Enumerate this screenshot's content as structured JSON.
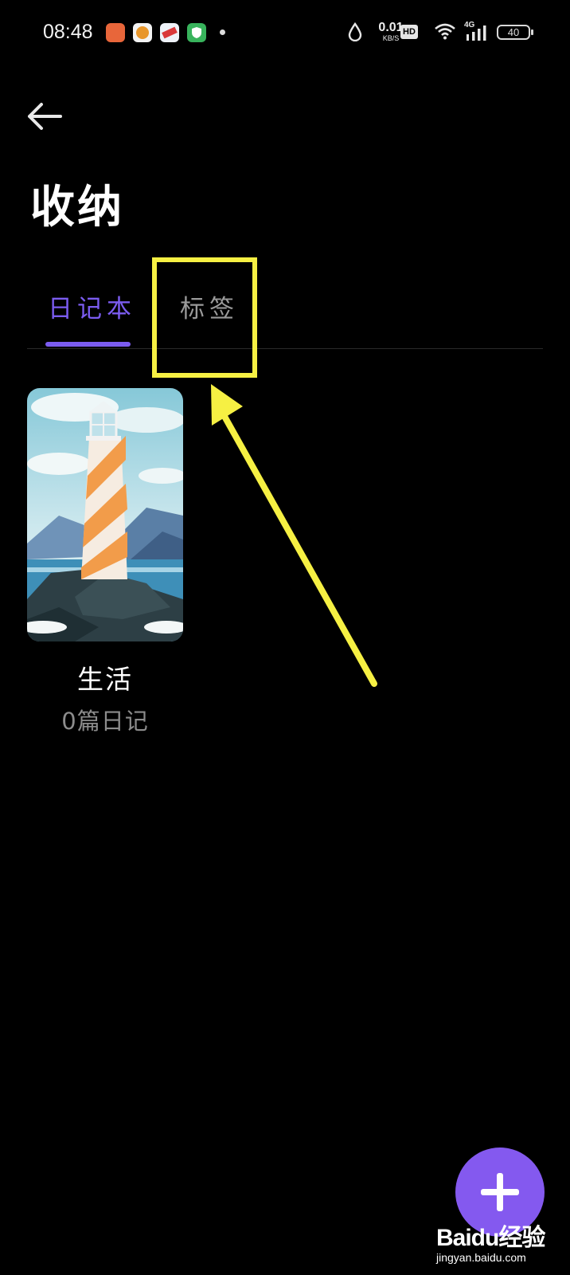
{
  "status_bar": {
    "time": "08:48",
    "net_speed_value": "0.01",
    "net_speed_unit": "KB/S",
    "hd_badge": "HD",
    "signal_badge": "4G",
    "battery": "40",
    "icons": [
      "app-icon",
      "app-icon",
      "app-icon",
      "shield-app-icon",
      "dot-icon",
      "drop-icon",
      "wifi-icon",
      "signal-icon",
      "battery-icon"
    ]
  },
  "header": {
    "title": "收纳"
  },
  "tabs": [
    {
      "label": "日记本",
      "selected": true
    },
    {
      "label": "标签",
      "selected": false
    }
  ],
  "notebooks": [
    {
      "name": "生活",
      "count_text": "0篇日记",
      "cover": "lighthouse-cover"
    }
  ],
  "fab": {
    "icon": "plus-icon"
  },
  "watermark": {
    "logo": "Baidu经验",
    "url": "jingyan.baidu.com"
  },
  "colors": {
    "background": "#000000",
    "accent": "#7b5cf0",
    "fab": "#8459ef",
    "highlight_annotation": "#f6f043"
  }
}
